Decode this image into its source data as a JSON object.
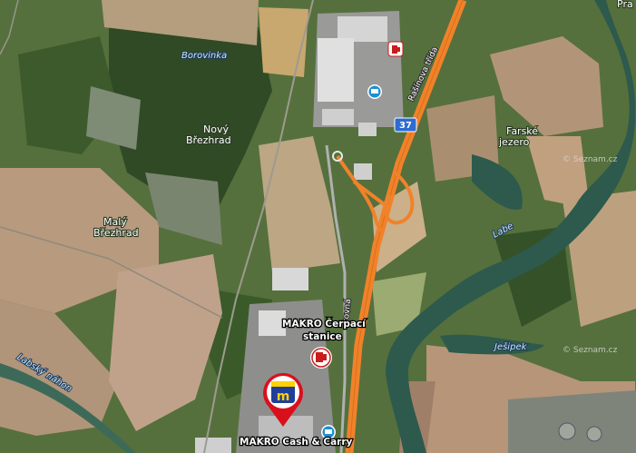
{
  "map": {
    "labels": {
      "borovinka": "Borovinka",
      "novy_brezhrad_1": "Nový",
      "novy_brezhrad_2": "Březhrad",
      "maly_brezhrad_1": "Malý",
      "maly_brezhrad_2": "Březhrad",
      "rasinova_trida": "Rašínova třída",
      "road_number": "37",
      "farske_jezero_1": "Farské",
      "farske_jezero_2": "jezero",
      "labe": "Labe",
      "jesipek": "Ješipek",
      "labsky_nahon": "Labský náhon",
      "street_partial": "tovná",
      "makro_fuel_1": "MAKRO Čerpací",
      "makro_fuel_2": "stanice",
      "makro_cash": "MAKRO Cash & Carry",
      "pra_partial": "Pra",
      "watermark_1": "© Seznam.cz",
      "watermark_2": "© Seznam.cz"
    },
    "icons": {
      "selected_marker": "makro-m-pin",
      "fuel_small": "fuel-pump",
      "fuel_poi": "fuel-pump",
      "shop_1": "shopping",
      "shop_2": "shopping"
    },
    "colors": {
      "highway": "#f0822a",
      "river": "#2d5a4c",
      "marker_red": "#d9101c",
      "marker_blue": "#1f3f9a",
      "marker_yellow": "#ffd200",
      "road_badge": "#2d6bd1"
    }
  }
}
